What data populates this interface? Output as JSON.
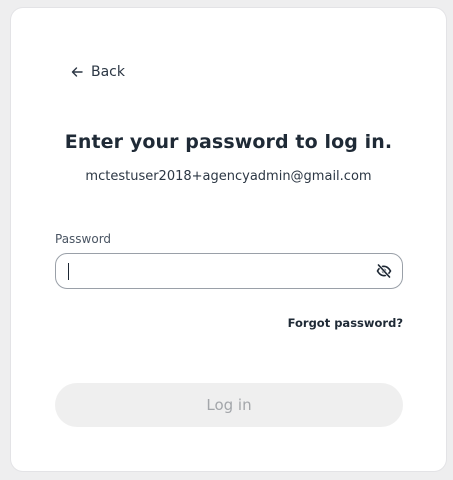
{
  "back": {
    "label": "Back",
    "icon": "arrow-left-icon"
  },
  "heading": "Enter your password to log in.",
  "email": "mctestuser2018+agencyadmin@gmail.com",
  "password_field": {
    "label": "Password",
    "value": "",
    "toggle_icon": "eye-off-icon"
  },
  "forgot_link": "Forgot password?",
  "login_button": {
    "label": "Log in",
    "state": "disabled"
  },
  "colors": {
    "background": "#eeeeef",
    "card": "#ffffff",
    "text": "#1d2733",
    "button_disabled_bg": "#efefef",
    "button_disabled_text": "#a3a6aa"
  }
}
